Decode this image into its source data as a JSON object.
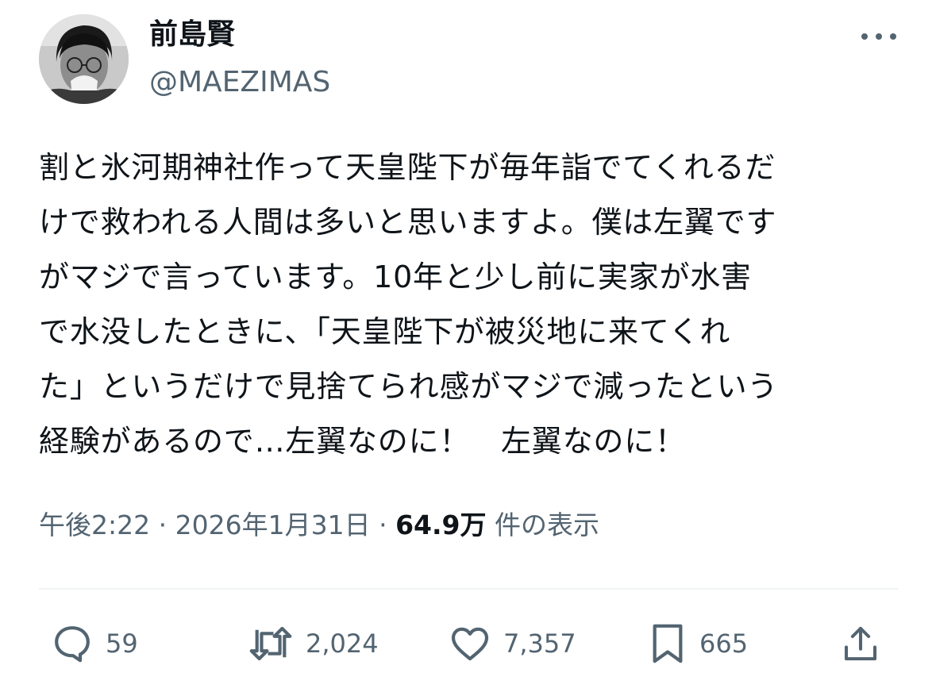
{
  "author": {
    "display_name": "前島賢",
    "handle": "@MAEZIMAS"
  },
  "tweet": {
    "lines": [
      "割と氷河期神社作って天皇陛下が毎年詣でてくれるだ",
      "けで救われる人間は多いと思いますよ。僕は左翼です",
      "がマジで言っています。10年と少し前に実家が水害",
      "で水没したときに、「天皇陛下が被災地に来てくれ",
      "た」というだけで見捨てられ感がマジで減ったという",
      "経験があるので…左翼なのに！　左翼なのに！"
    ],
    "time": "午後2:22",
    "separator": "·",
    "date": "2026年1月31日",
    "views_count": "64.9万",
    "views_label": "件の表示"
  },
  "actions": {
    "reply_count": "59",
    "retweet_count": "2,024",
    "like_count": "7,357",
    "bookmark_count": "665"
  },
  "icons": {
    "more": "more-icon",
    "reply": "reply-icon",
    "retweet": "retweet-icon",
    "like": "heart-icon",
    "bookmark": "bookmark-icon",
    "share": "share-icon"
  },
  "colors": {
    "text_primary": "#0f1419",
    "text_secondary": "#536471",
    "divider": "#eff3f4"
  }
}
